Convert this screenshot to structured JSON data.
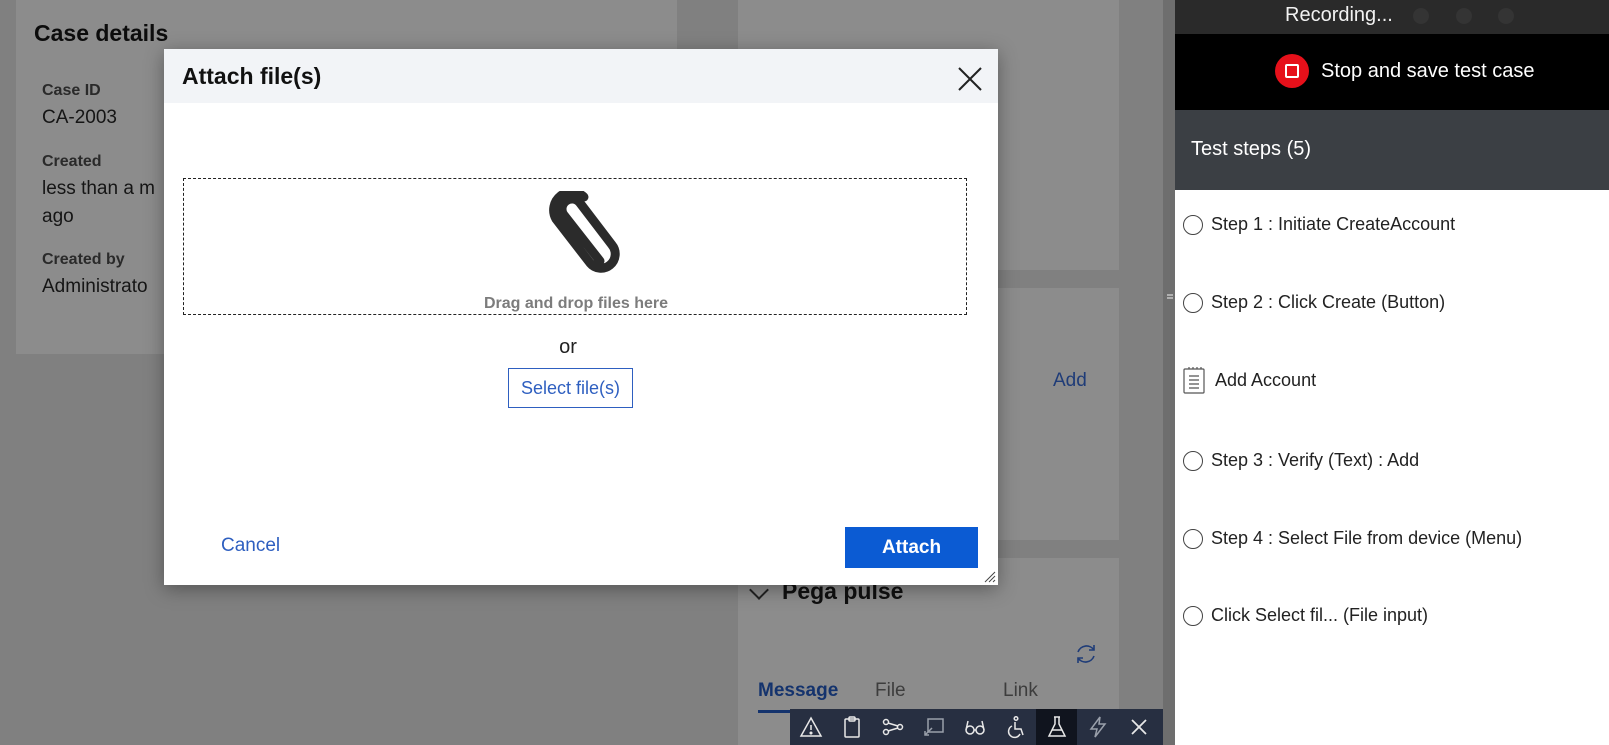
{
  "case_details": {
    "title": "Case details",
    "case_id_label": "Case ID",
    "case_id_value": "CA-2003",
    "created_label": "Created",
    "created_value_line1": "less than a m",
    "created_value_line2": "ago",
    "created_by_label": "Created by",
    "created_by_value": "Administrato"
  },
  "background": {
    "add_link": "Add",
    "pulse_title": "Pega pulse",
    "tabs": [
      {
        "label": "Message"
      },
      {
        "label": "File"
      },
      {
        "label": "Link"
      }
    ]
  },
  "dev_toolbar": {
    "icons": [
      "warning-icon",
      "clipboard-icon",
      "tracer-icon",
      "live-ui-icon",
      "glasses-icon",
      "accessibility-icon",
      "flask-icon",
      "lightning-icon",
      "close-icon"
    ]
  },
  "recorder": {
    "status": "Recording...",
    "stop_label": "Stop and save test case",
    "steps_title": "Test steps  (5)",
    "steps": [
      {
        "label": "Step 1 : Initiate CreateAccount",
        "icon": "radio"
      },
      {
        "label": "Step 2 : Click Create (Button)",
        "icon": "radio"
      },
      {
        "label": "Add Account",
        "icon": "clipboard"
      },
      {
        "label": "Step 3 : Verify (Text) : Add",
        "icon": "radio"
      },
      {
        "label": "Step 4 : Select File from device (Menu)",
        "icon": "radio"
      },
      {
        "label": "Click Select fil... (File input)",
        "icon": "radio"
      }
    ]
  },
  "modal": {
    "title": "Attach file(s)",
    "drop_text": "Drag and drop files here",
    "or_text": "or",
    "select_label": "Select file(s)",
    "cancel_label": "Cancel",
    "attach_label": "Attach",
    "accent": "#0b5bd3"
  }
}
